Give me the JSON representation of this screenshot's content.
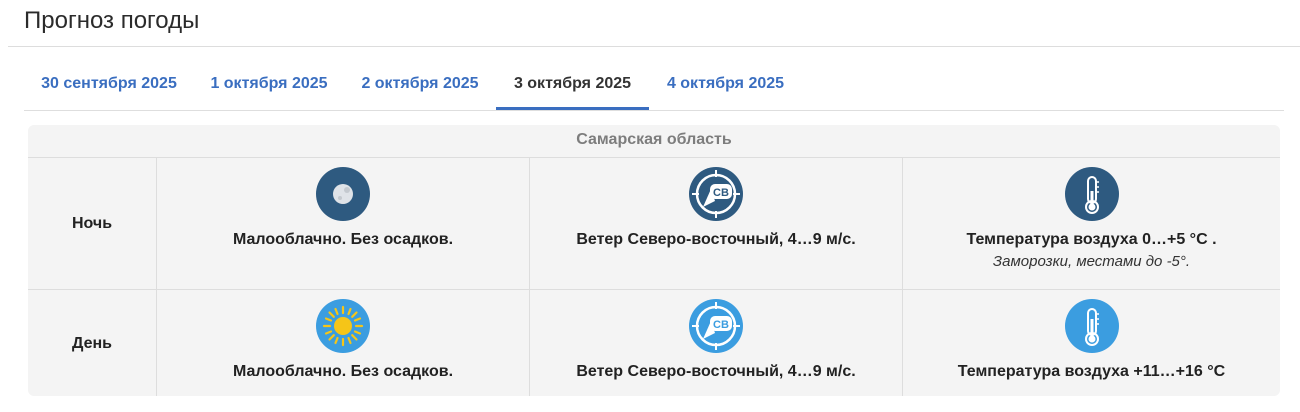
{
  "page_title": "Прогноз погоды",
  "tabs": [
    {
      "label": "30 сентября 2025",
      "active": false
    },
    {
      "label": "1 октября 2025",
      "active": false
    },
    {
      "label": "2 октября 2025",
      "active": false
    },
    {
      "label": "3 октября 2025",
      "active": true
    },
    {
      "label": "4 октября 2025",
      "active": false
    }
  ],
  "region": "Самарская область",
  "rows": [
    {
      "period": "Ночь",
      "sky": {
        "icon": "moon-icon",
        "text": "Малооблачно. Без осадков."
      },
      "wind": {
        "icon": "wind-compass-icon",
        "direction_code": "СВ",
        "text": "Ветер Северо-восточный, 4…9 м/с."
      },
      "temp": {
        "icon": "thermometer-icon",
        "text": "Температура воздуха 0…+5 °С .",
        "note": "Заморозки, местами до -5°."
      }
    },
    {
      "period": "День",
      "sky": {
        "icon": "sun-icon",
        "text": "Малооблачно. Без осадков."
      },
      "wind": {
        "icon": "wind-compass-icon",
        "direction_code": "СВ",
        "text": "Ветер Северо-восточный, 4…9 м/с."
      },
      "temp": {
        "icon": "thermometer-icon",
        "text": "Температура воздуха +11…+16 °С",
        "note": ""
      }
    }
  ],
  "colors": {
    "tab_link": "#3a6ec0",
    "night_icon": "#2e5a80",
    "day_icon": "#3b9de0",
    "sun": "#f5c518"
  }
}
